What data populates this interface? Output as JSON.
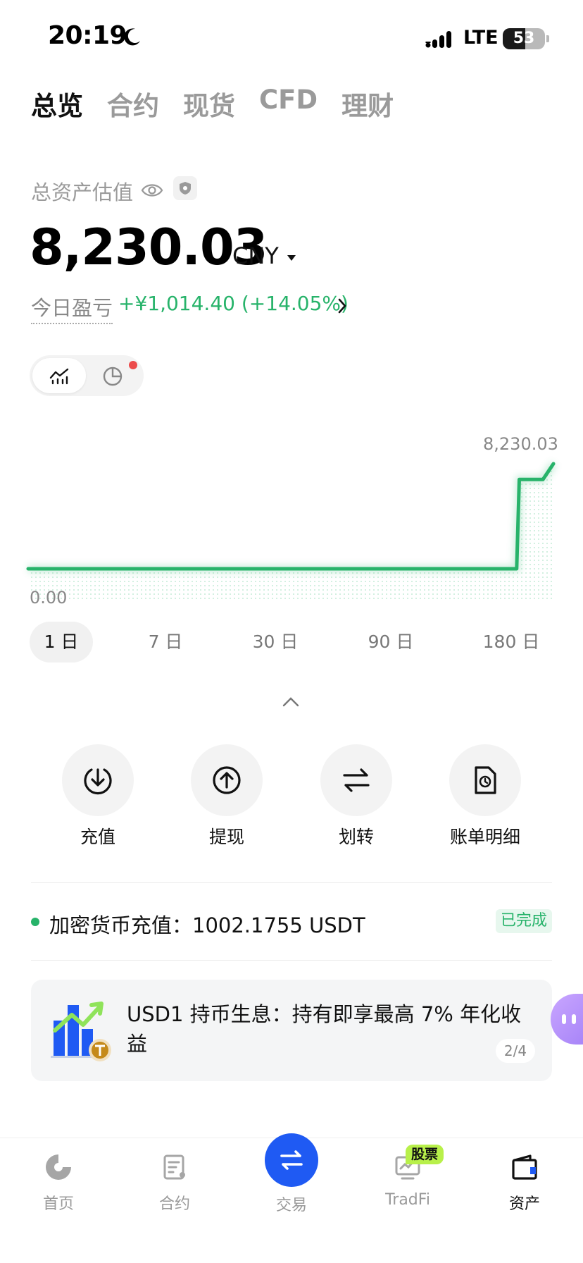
{
  "status_bar": {
    "time": "20:19",
    "network": "LTE",
    "battery": "53"
  },
  "tabs": [
    {
      "label": "总览",
      "active": true
    },
    {
      "label": "合约",
      "active": false
    },
    {
      "label": "现货",
      "active": false
    },
    {
      "label": "CFD",
      "active": false
    },
    {
      "label": "理财",
      "active": false
    }
  ],
  "summary": {
    "label": "总资产估值",
    "value": "8,230.03",
    "currency": "CNY",
    "pnl_label": "今日盈亏",
    "pnl_value": "+¥1,014.40 (+14.05%)"
  },
  "chart_data": {
    "type": "line",
    "max_label": "8,230.03",
    "min_label": "0.00",
    "x": [
      0,
      0.5,
      0.93,
      0.935,
      0.98,
      1.0
    ],
    "values": [
      0,
      0,
      0,
      7000,
      7000,
      8230.03
    ],
    "ylim": [
      0,
      8230.03
    ],
    "color": "#27b36a"
  },
  "ranges": [
    {
      "label": "1 日",
      "active": true
    },
    {
      "label": "7 日",
      "active": false
    },
    {
      "label": "30 日",
      "active": false
    },
    {
      "label": "90 日",
      "active": false
    },
    {
      "label": "180 日",
      "active": false
    }
  ],
  "actions": [
    {
      "label": "充值",
      "icon": "download-icon"
    },
    {
      "label": "提现",
      "icon": "upload-icon"
    },
    {
      "label": "划转",
      "icon": "transfer-icon"
    },
    {
      "label": "账单明细",
      "icon": "bill-icon"
    }
  ],
  "deposit": {
    "text": "加密货币充值：1002.1755 USDT",
    "status": "已完成"
  },
  "promo": {
    "text": "USD1 持币生息：持有即享最高 7% 年化收益",
    "page": "2/4"
  },
  "bottom_nav": [
    {
      "label": "首页",
      "icon": "home-icon",
      "active": false
    },
    {
      "label": "合约",
      "icon": "contract-icon",
      "active": false
    },
    {
      "label": "交易",
      "icon": "swap-icon",
      "active": false
    },
    {
      "label": "TradFi",
      "icon": "tradfi-icon",
      "active": false,
      "badge": "股票"
    },
    {
      "label": "资产",
      "icon": "wallet-icon",
      "active": true
    }
  ],
  "colors": {
    "accent": "#1f5af3",
    "positive": "#27b36a",
    "alert": "#ec4b4b"
  }
}
